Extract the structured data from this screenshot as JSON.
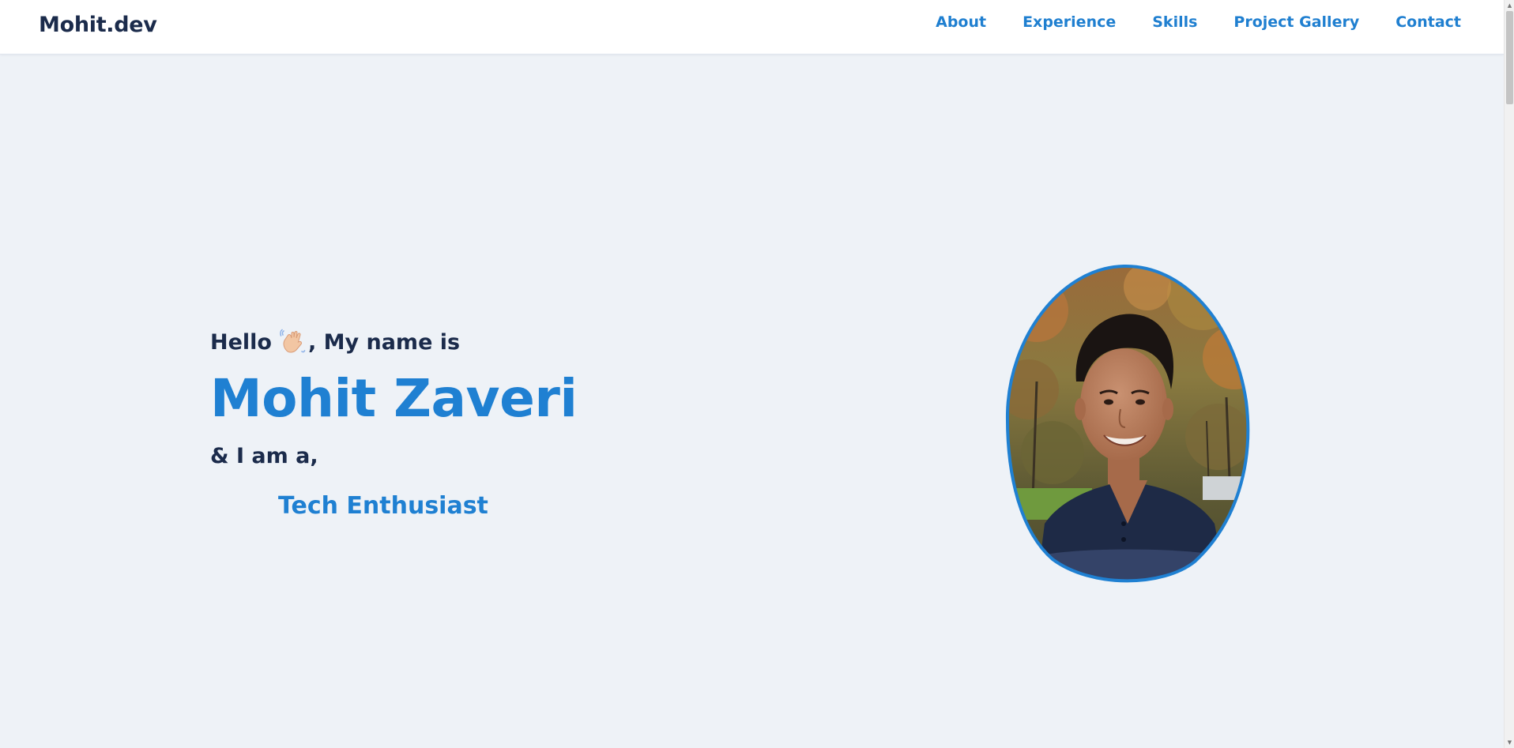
{
  "nav": {
    "brand": "Mohit.dev",
    "links": [
      {
        "label": "About"
      },
      {
        "label": "Experience"
      },
      {
        "label": "Skills"
      },
      {
        "label": "Project Gallery"
      },
      {
        "label": "Contact"
      }
    ]
  },
  "hero": {
    "greeting_before": "Hello",
    "greeting_after": ", My name is",
    "greeting_icon": "waving-hand-icon",
    "name": "Mohit Zaveri",
    "intro": "& I am a,",
    "role": "Tech Enthusiast",
    "portrait_icon": "profile-photo"
  },
  "colors": {
    "accent": "#1f80d2",
    "heading": "#1b2b4b",
    "background": "#eef2f7",
    "nav_background": "#ffffff"
  }
}
